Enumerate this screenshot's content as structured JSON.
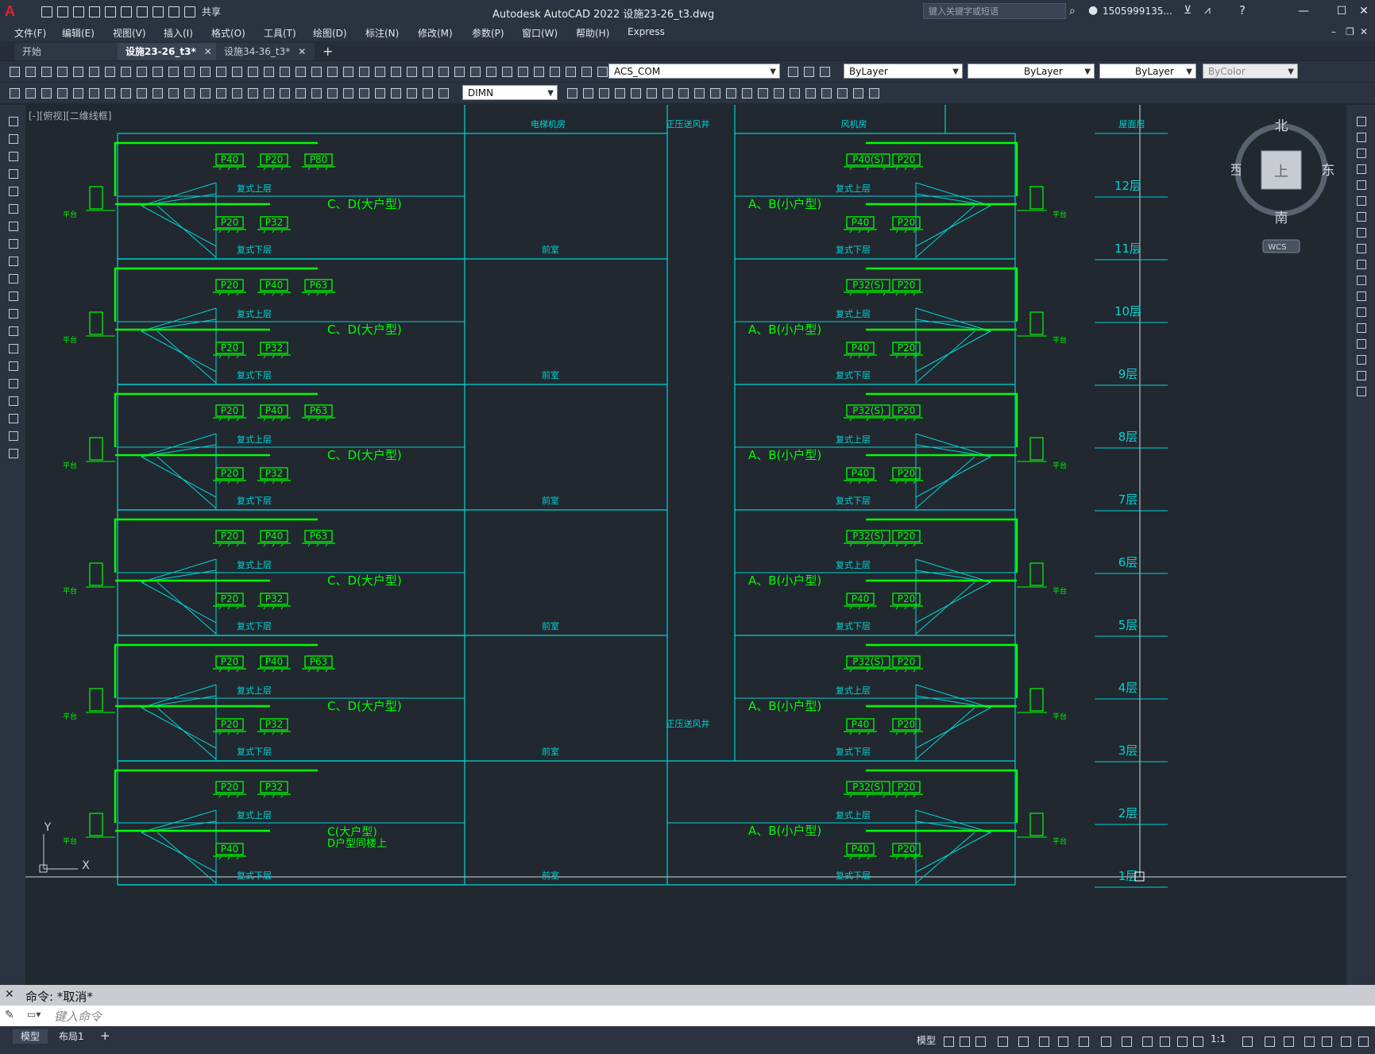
{
  "app": {
    "title": "Autodesk AutoCAD 2022    设施23-26_t3.dwg",
    "share_label": "共享",
    "search_placeholder": "键入关键字或短语",
    "user": "1505999135...",
    "logo": "A"
  },
  "menu": [
    "文件(F)",
    "编辑(E)",
    "视图(V)",
    "插入(I)",
    "格式(O)",
    "工具(T)",
    "绘图(D)",
    "标注(N)",
    "修改(M)",
    "参数(P)",
    "窗口(W)",
    "帮助(H)",
    "Express"
  ],
  "tabs": [
    {
      "label": "开始"
    },
    {
      "label": "设施23-26_t3*",
      "active": true
    },
    {
      "label": "设施34-36_t3*"
    }
  ],
  "toolbar": {
    "layer": "ACS_COM",
    "color": "ByLayer",
    "linetype": "ByLayer",
    "lineweight": "ByLayer",
    "plotstyle": "ByColor",
    "dimstyle": "DIMN"
  },
  "viewport_label": "[-][俯视][二维线框]",
  "viewcube": {
    "north": "北",
    "south": "南",
    "east": "东",
    "west": "西",
    "top": "上",
    "wcs": "WCS"
  },
  "ucs": {
    "x": "X",
    "y": "Y"
  },
  "drawing": {
    "headers": {
      "elevator_room": "电梯机房",
      "pressure_shaft": "正压送风井",
      "fan_room": "风机房",
      "roof": "屋面层",
      "pressure_shaft_lower": "正压送风井"
    },
    "floor_labels": [
      "12层",
      "11层",
      "10层",
      "9层",
      "8层",
      "7层",
      "6层",
      "5层",
      "4层",
      "3层",
      "2层",
      "1层"
    ],
    "upper_label": "复式上层",
    "lower_label": "复式下层",
    "lobby": "前室",
    "outdoor_unit": "平台",
    "left_type": "C、D(大户型)",
    "right_type": "A、B(小户型)",
    "bottom_left_type_1": "C(大户型)",
    "bottom_left_type_2": "D户型同楼上",
    "left_upper_units": [
      [
        "P40",
        "P20",
        "P80"
      ],
      [
        "P20",
        "P40",
        "P63"
      ],
      [
        "P20",
        "P40",
        "P63"
      ],
      [
        "P20",
        "P40",
        "P63"
      ],
      [
        "P20",
        "P40",
        "P63"
      ],
      [
        "P20",
        "P32"
      ]
    ],
    "left_lower_units": [
      [
        "P20",
        "P32"
      ],
      [
        "P20",
        "P32"
      ],
      [
        "P20",
        "P32"
      ],
      [
        "P20",
        "P32"
      ],
      [
        "P20",
        "P32"
      ],
      [
        "P40"
      ]
    ],
    "right_upper_units": [
      [
        "P40(S)",
        "P20"
      ],
      [
        "P32(S)",
        "P20"
      ],
      [
        "P32(S)",
        "P20"
      ],
      [
        "P32(S)",
        "P20"
      ],
      [
        "P32(S)",
        "P20"
      ],
      [
        "P32(S)",
        "P20"
      ]
    ],
    "right_lower_units": [
      [
        "P40",
        "P20"
      ],
      [
        "P40",
        "P20"
      ],
      [
        "P40",
        "P20"
      ],
      [
        "P40",
        "P20"
      ],
      [
        "P40",
        "P20"
      ],
      [
        "P40",
        "P20"
      ]
    ]
  },
  "command": {
    "history": "命令:  *取消*",
    "placeholder": "键入命令"
  },
  "status": {
    "model_tab": "模型",
    "layout_tab": "布局1",
    "model_button": "模型",
    "scale": "1:1"
  },
  "colors": {
    "cyan": "#00d4d4",
    "green": "#00ff00",
    "background": "#212830"
  }
}
